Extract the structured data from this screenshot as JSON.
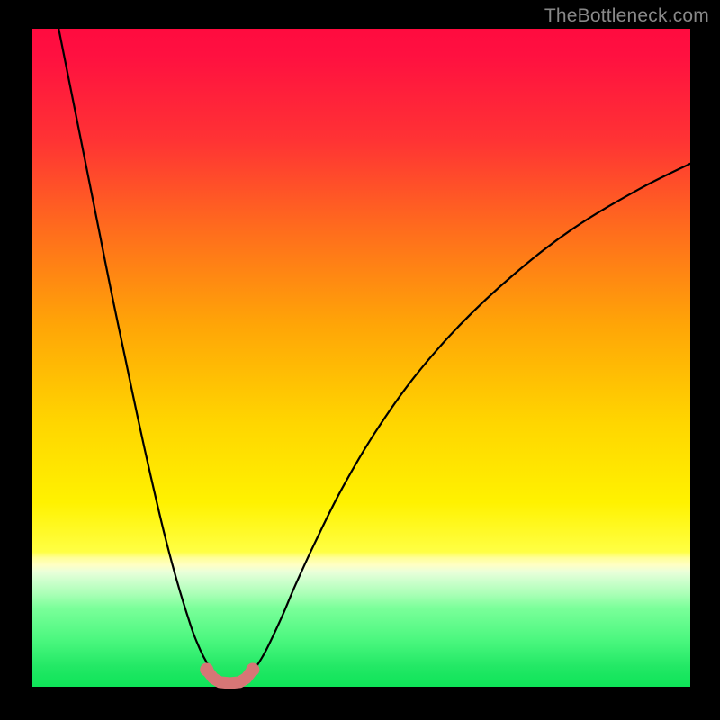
{
  "watermark": "TheBottleneck.com",
  "colors": {
    "background": "#000000",
    "curve": "#000000",
    "segments": "#d77676"
  },
  "chart_data": {
    "type": "line",
    "title": "",
    "xlabel": "",
    "ylabel": "",
    "xlim": [
      0,
      100
    ],
    "ylim": [
      0,
      100
    ],
    "grid": false,
    "series": [
      {
        "name": "left-curve",
        "x": [
          4,
          6,
          8,
          10,
          12,
          14,
          16,
          18,
          20,
          22,
          24,
          25,
          26,
          27,
          28
        ],
        "y": [
          100,
          90,
          80,
          70,
          60,
          50.5,
          41,
          32,
          23.5,
          16,
          9.5,
          6.8,
          4.6,
          2.9,
          1.6
        ]
      },
      {
        "name": "right-curve",
        "x": [
          33,
          34,
          35,
          36,
          38,
          40,
          43,
          47,
          52,
          58,
          65,
          73,
          82,
          92,
          100
        ],
        "y": [
          1.6,
          3.0,
          4.6,
          6.5,
          10.8,
          15.5,
          22,
          30,
          38.5,
          47,
          55,
          62.5,
          69.5,
          75.5,
          79.5
        ]
      },
      {
        "name": "bottom-segments",
        "points": [
          {
            "x": 26.5,
            "y": 2.6,
            "type": "dot"
          },
          {
            "x": 27.5,
            "y": 1.3,
            "type": "joint"
          },
          {
            "x": 28.5,
            "y": 0.7,
            "type": "joint"
          },
          {
            "x": 30.0,
            "y": 0.55,
            "type": "joint"
          },
          {
            "x": 31.5,
            "y": 0.7,
            "type": "joint"
          },
          {
            "x": 32.5,
            "y": 1.3,
            "type": "joint"
          },
          {
            "x": 33.5,
            "y": 2.6,
            "type": "dot"
          }
        ]
      }
    ]
  }
}
